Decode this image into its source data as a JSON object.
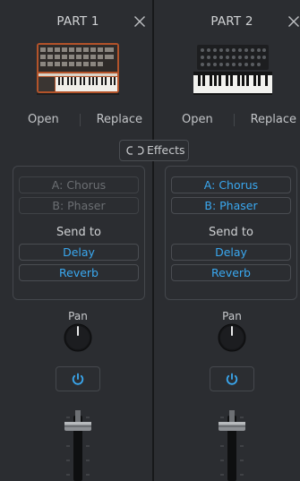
{
  "effects_button": {
    "label": "Effects",
    "icon": "link-icon"
  },
  "parts": [
    {
      "title": "PART 1",
      "open_label": "Open",
      "replace_label": "Replace",
      "slot_a": "A: Chorus",
      "slot_b": "B: Phaser",
      "slots_enabled": false,
      "send_to_label": "Send to",
      "send_delay": "Delay",
      "send_reverb": "Reverb",
      "pan_label": "Pan",
      "synth": "orange-analog-synth"
    },
    {
      "title": "PART 2",
      "open_label": "Open",
      "replace_label": "Replace",
      "slot_a": "A: Chorus",
      "slot_b": "B: Phaser",
      "slots_enabled": true,
      "send_to_label": "Send to",
      "send_delay": "Delay",
      "send_reverb": "Reverb",
      "pan_label": "Pan",
      "synth": "black-analog-synth"
    }
  ],
  "colors": {
    "accent": "#3aa8f0",
    "background": "#2b2d31",
    "text": "#c9cbce",
    "dim_text": "#6b6e72"
  }
}
